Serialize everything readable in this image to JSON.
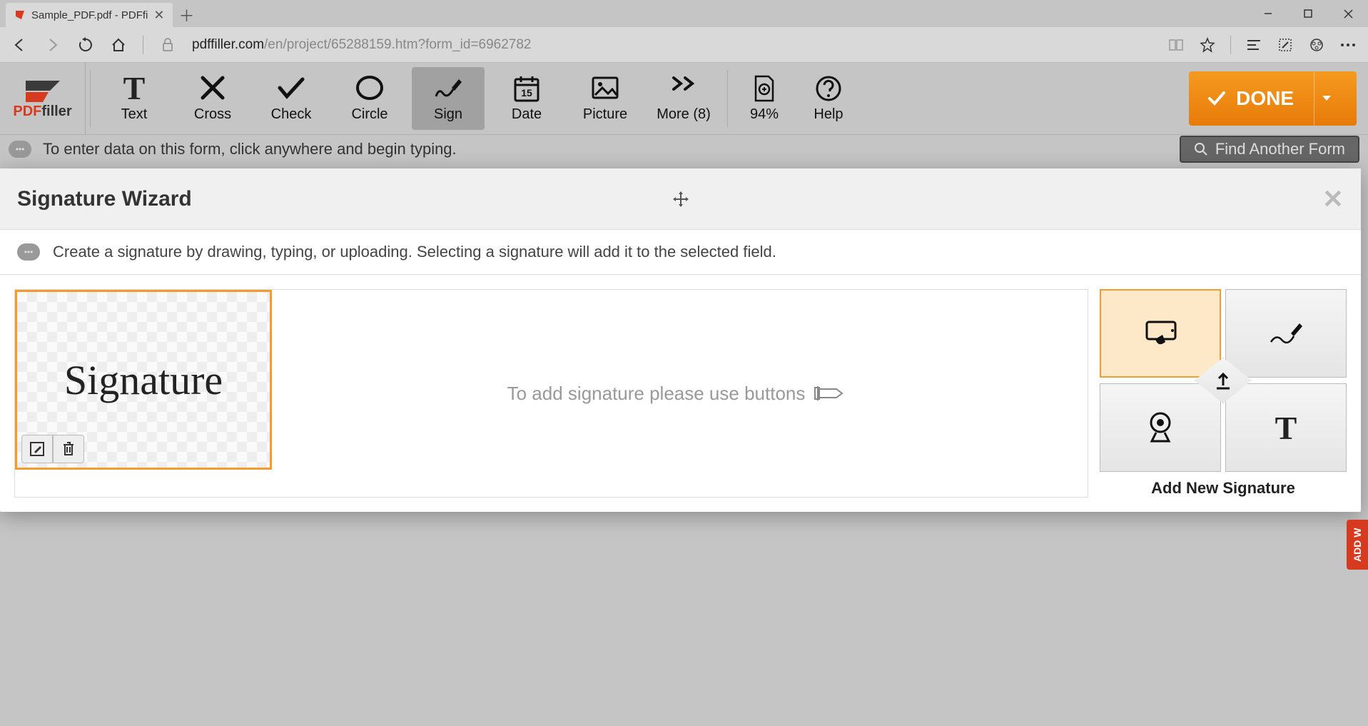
{
  "browser": {
    "tab_title": "Sample_PDF.pdf - PDFfi",
    "url_host": "pdffiller.com",
    "url_path": "/en/project/65288159.htm?form_id=6962782"
  },
  "logo": {
    "pdf": "PDF",
    "filler": "filler"
  },
  "toolbar": {
    "text": "Text",
    "cross": "Cross",
    "check": "Check",
    "circle": "Circle",
    "sign": "Sign",
    "date": "Date",
    "picture": "Picture",
    "more": "More (8)",
    "zoom": "94%",
    "help": "Help",
    "done": "DONE",
    "date_day": "15"
  },
  "hint": "To enter data on this form, click anywhere and begin typing.",
  "find_form": "Find Another Form",
  "modal": {
    "title": "Signature Wizard",
    "subtitle": "Create a signature by drawing, typing, or uploading. Selecting a signature will add it to the selected field.",
    "sig_sample": "Signature",
    "prompt": "To add signature please use buttons",
    "add_label": "Add New Signature"
  },
  "side_tab": "ADD W"
}
